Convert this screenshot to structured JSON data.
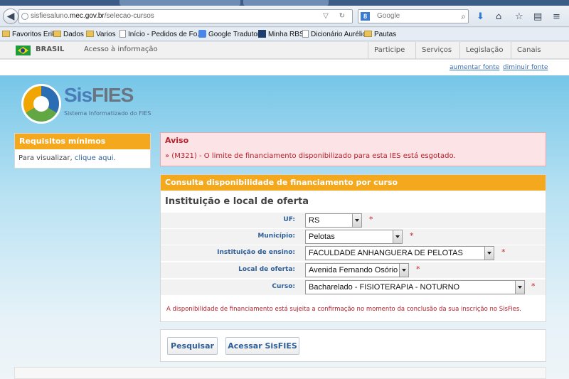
{
  "browser": {
    "url_prefix": "sisfiesaluno.",
    "url_domain": "mec.gov.br",
    "url_path": "/selecao-cursos",
    "search_placeholder": "Google",
    "search_engine_badge": "8"
  },
  "bookmarks": [
    {
      "label": "Favoritos Erik",
      "icon": "folder-icon"
    },
    {
      "label": "Dados",
      "icon": "folder-icon"
    },
    {
      "label": "Varios",
      "icon": "folder-icon"
    },
    {
      "label": "Início - Pedidos de Fo...",
      "icon": "page-icon"
    },
    {
      "label": "Google Tradutor",
      "icon": "google-translate-icon"
    },
    {
      "label": "Minha RBS",
      "icon": "rbs-icon"
    },
    {
      "label": "Dicionário Aurélio",
      "icon": "page-icon"
    },
    {
      "label": "Pautas",
      "icon": "folder-icon"
    }
  ],
  "govbar": {
    "brasil": "BRASIL",
    "acesso": "Acesso à informação",
    "links": [
      "Participe",
      "Serviços",
      "Legislação",
      "Canais"
    ]
  },
  "fontbar": {
    "increase": "aumentar fonte",
    "decrease": "diminuir fonte"
  },
  "logo": {
    "sis": "Sis",
    "fies": "FIES",
    "subtitle": "Sistema Informatizado do FIES"
  },
  "requisitos": {
    "title": "Requisitos mínimos",
    "text": "Para visualizar, ",
    "link": "clique aqui."
  },
  "aviso": {
    "title": "Aviso",
    "message": "» (M321) - O limite de financiamento disponibilizado para esta IES está esgotado."
  },
  "consulta": {
    "title": "Consulta disponibilidade de financiamento por curso",
    "subtitle": "Instituição e local de oferta",
    "fields": [
      {
        "label": "UF:",
        "value": "RS"
      },
      {
        "label": "Município:",
        "value": "Pelotas"
      },
      {
        "label": "Instituição de ensino:",
        "value": "FACULDADE ANHANGUERA DE PELOTAS"
      },
      {
        "label": "Local de oferta:",
        "value": "Avenida Fernando Osório"
      },
      {
        "label": "Curso:",
        "value": "Bacharelado - FISIOTERAPIA - NOTURNO"
      }
    ],
    "required_mark": "*",
    "disclaimer": "A disponibilidade de financiamento está sujeita a confirmação no momento da conclusão da sua inscrição no SisFies."
  },
  "buttons": {
    "search": "Pesquisar",
    "access": "Acessar SisFIES"
  },
  "colors": {
    "accent_orange": "#f3a81e",
    "link_blue": "#2f5f99",
    "error_red": "#b8202c"
  }
}
